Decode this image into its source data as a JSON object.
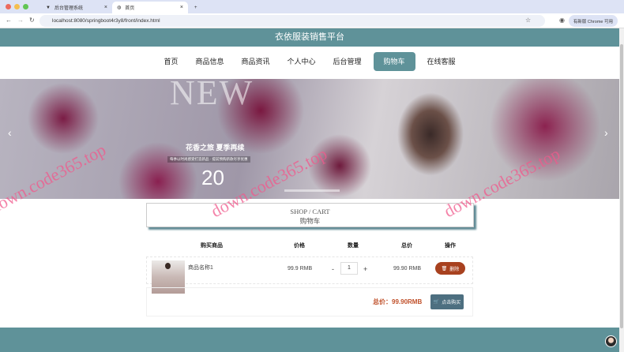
{
  "browser": {
    "tabs": [
      {
        "title": "后台管理系统"
      },
      {
        "title": "首页"
      }
    ],
    "url": "localhost:8080/springboot4r3y8/front/index.html",
    "update_label": "有新版 Chrome 可用"
  },
  "site": {
    "title": "衣依服装销售平台"
  },
  "nav": [
    {
      "label": "首页"
    },
    {
      "label": "商品信息"
    },
    {
      "label": "商品资讯"
    },
    {
      "label": "个人中心"
    },
    {
      "label": "后台管理"
    },
    {
      "label": "购物车"
    },
    {
      "label": "在线客服"
    }
  ],
  "banner": {
    "headline": "NEW",
    "subtitle": "花香之旅 夏季再续",
    "tagline": "每季以时尚感受打造新品 · 提前预购新款尽享优惠",
    "year": "20"
  },
  "cart": {
    "title_en": "SHOP / CART",
    "title_cn": "购物车",
    "headers": {
      "product": "购买商品",
      "price": "价格",
      "quantity": "数量",
      "subtotal": "总价",
      "action": "操作"
    },
    "items": [
      {
        "name": "商品名称1",
        "price": "99.9 RMB",
        "quantity": "1",
        "subtotal": "99.90 RMB",
        "delete_label": "删除"
      }
    ],
    "minus": "-",
    "plus": "+",
    "total": "总价：99.90RMB",
    "buy_label": "点击购买"
  },
  "watermark": "down.code365.top"
}
